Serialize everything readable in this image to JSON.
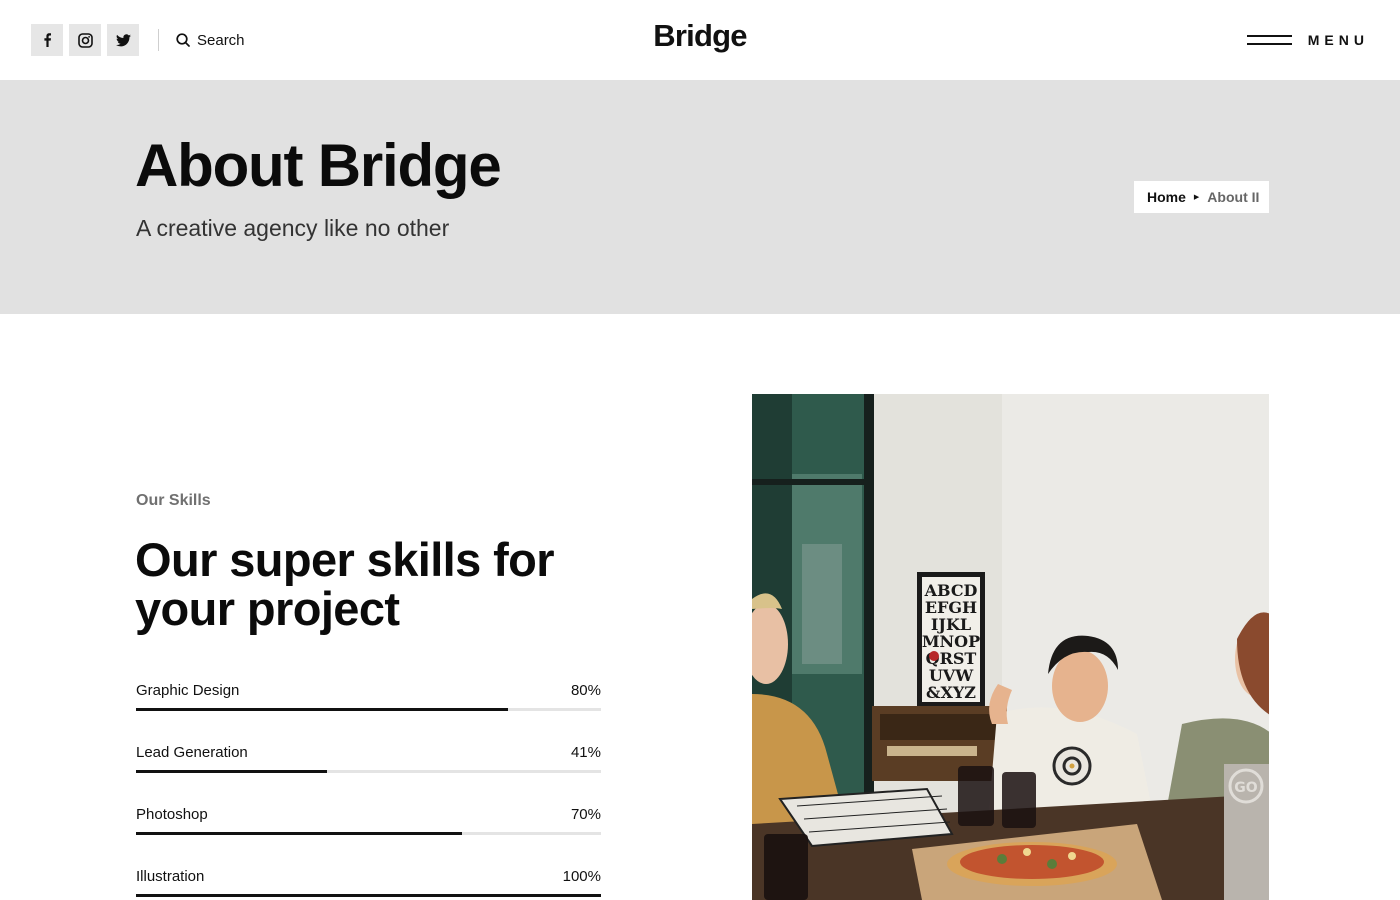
{
  "header": {
    "social": [
      {
        "name": "facebook",
        "icon": "facebook-icon"
      },
      {
        "name": "instagram",
        "icon": "instagram-icon"
      },
      {
        "name": "twitter",
        "icon": "twitter-icon"
      }
    ],
    "search_label": "Search",
    "search_icon": "search-icon",
    "logo": "Bridge",
    "menu_label": "MENU",
    "menu_icon": "hamburger-icon"
  },
  "hero": {
    "title": "About Bridge",
    "subtitle": "A creative agency like no other",
    "breadcrumb": {
      "home": "Home",
      "separator_icon": "caret-right-icon",
      "current": "About II"
    }
  },
  "skills": {
    "eyebrow": "Our Skills",
    "title": "Our super skills for your project",
    "items": [
      {
        "label": "Graphic Design",
        "percent_label": "80%",
        "value": 0.8
      },
      {
        "label": "Lead Generation",
        "percent_label": "41%",
        "value": 0.41
      },
      {
        "label": "Photoshop",
        "percent_label": "70%",
        "value": 0.7
      },
      {
        "label": "Illustration",
        "percent_label": "100%",
        "value": 1.0
      }
    ]
  },
  "photo": {
    "poster_lines": [
      "ABCD",
      "EFGH",
      "IJKL",
      "MNOP",
      "QRST",
      "UVW",
      "&XYZ"
    ],
    "cup_mark": "GO"
  },
  "colors": {
    "hero_background": "#e1e1e1",
    "text": "#111111",
    "muted": "#707070",
    "bar_fill": "#111111",
    "bar_track": "#e4e4e4"
  }
}
